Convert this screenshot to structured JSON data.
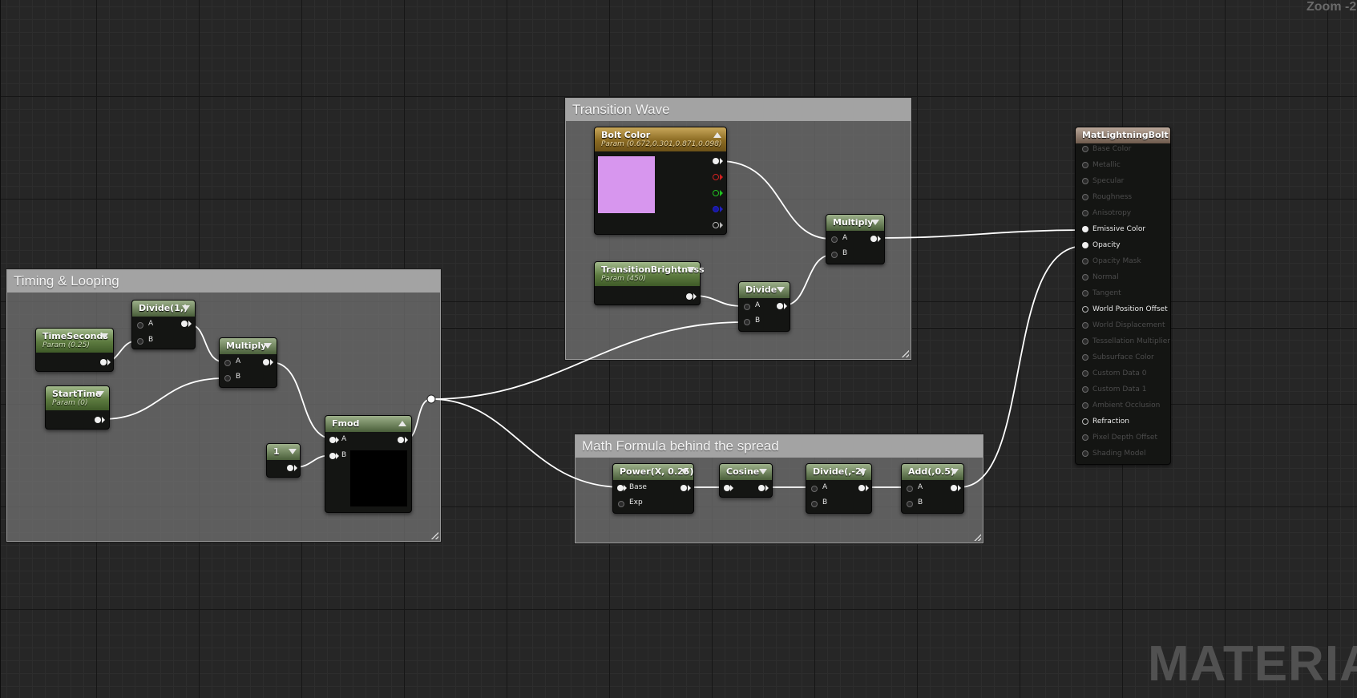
{
  "canvas": {
    "zoom_label": "Zoom -2",
    "watermark": "MATERIAL"
  },
  "comments": {
    "timing": "Timing & Looping",
    "transition": "Transition Wave",
    "math": "Math Formula behind the spread"
  },
  "nodes": {
    "time_seconds": {
      "title": "TimeSeconds",
      "subtitle": "Param (0.25)"
    },
    "start_time": {
      "title": "StartTime",
      "subtitle": "Param (0)"
    },
    "divide1": {
      "title": "Divide(1,)",
      "pin_a": "A",
      "pin_b": "B"
    },
    "multiply1": {
      "title": "Multiply",
      "pin_a": "A",
      "pin_b": "B"
    },
    "const1": {
      "title": "1"
    },
    "fmod": {
      "title": "Fmod",
      "pin_a": "A",
      "pin_b": "B"
    },
    "bolt_color": {
      "title": "Bolt Color",
      "subtitle": "Param (0.672,0.301,0.871,0.098)",
      "swatch_color": "#d796ee"
    },
    "transition_brightness": {
      "title": "TransitionBrightness",
      "subtitle": "Param (450)"
    },
    "divide2": {
      "title": "Divide",
      "pin_a": "A",
      "pin_b": "B"
    },
    "multiply2": {
      "title": "Multiply",
      "pin_a": "A",
      "pin_b": "B"
    },
    "power": {
      "title": "Power(X, 0.25)",
      "pin_base": "Base",
      "pin_exp": "Exp"
    },
    "cosine": {
      "title": "Cosine"
    },
    "divide_neg2": {
      "title": "Divide(,-2)",
      "pin_a": "A",
      "pin_b": "B"
    },
    "add": {
      "title": "Add(,0.5)",
      "pin_a": "A",
      "pin_b": "B"
    }
  },
  "material": {
    "title": "MatLightningBolt",
    "inputs": [
      {
        "label": "Base Color",
        "active": false
      },
      {
        "label": "Metallic",
        "active": false
      },
      {
        "label": "Specular",
        "active": false
      },
      {
        "label": "Roughness",
        "active": false
      },
      {
        "label": "Anisotropy",
        "active": false
      },
      {
        "label": "Emissive Color",
        "active": true,
        "connected": true
      },
      {
        "label": "Opacity",
        "active": true,
        "connected": true
      },
      {
        "label": "Opacity Mask",
        "active": false
      },
      {
        "label": "Normal",
        "active": false
      },
      {
        "label": "Tangent",
        "active": false
      },
      {
        "label": "World Position Offset",
        "active": true,
        "connected": false
      },
      {
        "label": "World Displacement",
        "active": false
      },
      {
        "label": "Tessellation Multiplier",
        "active": false
      },
      {
        "label": "Subsurface Color",
        "active": false
      },
      {
        "label": "Custom Data 0",
        "active": false
      },
      {
        "label": "Custom Data 1",
        "active": false
      },
      {
        "label": "Ambient Occlusion",
        "active": false
      },
      {
        "label": "Refraction",
        "active": true,
        "connected": false
      },
      {
        "label": "Pixel Depth Offset",
        "active": false
      },
      {
        "label": "Shading Model",
        "active": false
      }
    ]
  },
  "colors": {
    "wire": "#ffffff",
    "param_header": "#6f8a55",
    "vector_param_header": "#8a6a22",
    "material_header": "#6e5a4c"
  }
}
